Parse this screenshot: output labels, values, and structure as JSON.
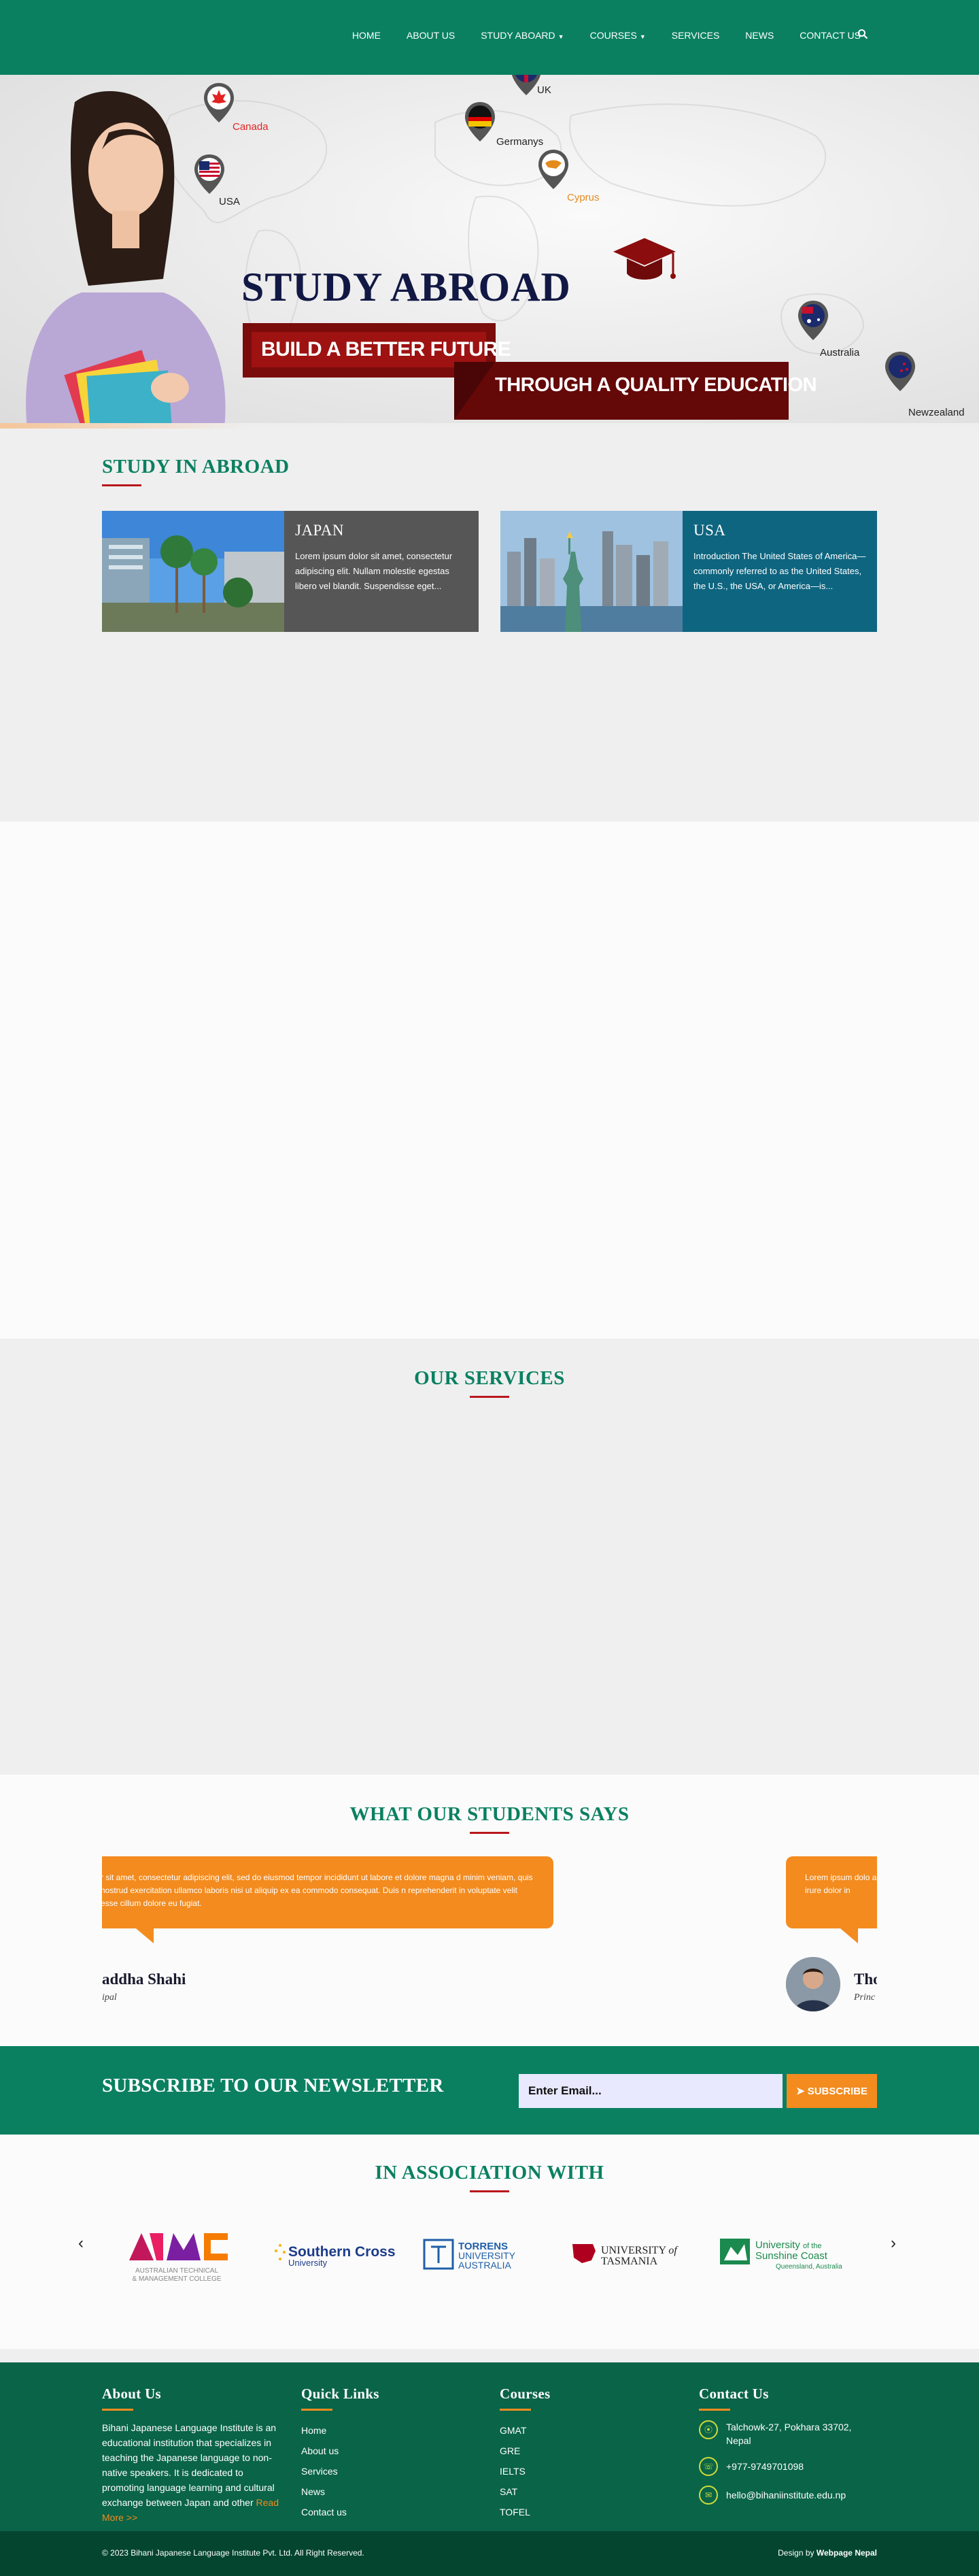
{
  "nav": {
    "items": [
      {
        "label": "HOME"
      },
      {
        "label": "ABOUT US"
      },
      {
        "label": "STUDY ABOARD"
      },
      {
        "label": "COURSES"
      },
      {
        "label": "SERVICES"
      },
      {
        "label": "NEWS"
      },
      {
        "label": "CONTACT US"
      }
    ],
    "search_icon": "search-icon"
  },
  "hero": {
    "title": "STUDY ABROAD",
    "banner1": "BUILD A BETTER FUTURE",
    "banner2": "THROUGH A QUALITY EDUCATION",
    "pins": [
      {
        "label": "Canada",
        "color": "#e32222"
      },
      {
        "label": "USA",
        "color": "#1a2a6c"
      },
      {
        "label": "UK",
        "color": "#c8102e"
      },
      {
        "label": "Germanys",
        "color": "#111111"
      },
      {
        "label": "Cyprus",
        "color": "#e48b1c"
      },
      {
        "label": "Australia",
        "color": "#1a2a6c"
      },
      {
        "label": "Newzealand",
        "color": "#1a2a6c"
      }
    ]
  },
  "abroad": {
    "title": "STUDY IN ABROAD",
    "cards": [
      {
        "title": "JAPAN",
        "text": "Lorem ipsum dolor sit amet, consectetur adipiscing elit. Nullam molestie egestas libero vel blandit. Suspendisse eget..."
      },
      {
        "title": "USA",
        "text": "Introduction The United States of America—commonly referred to as the United States, the U.S., the USA, or America—is..."
      }
    ]
  },
  "services": {
    "title": "OUR SERVICES"
  },
  "testimonials": {
    "title": "WHAT OUR STUDENTS SAYS",
    "items": [
      {
        "text": "r sit amet, consectetur adipiscing elit, sed do eiusmod tempor incididunt ut labore et dolore magna d minim veniam, quis nostrud exercitation ullamco laboris nisi ut aliquip ex ea commodo consequat. Duis n reprehenderit in voluptate velit esse cillum dolore eu fugiat.",
        "name": "addha Shahi",
        "role": "ipal"
      },
      {
        "text": "Lorem ipsum dolo aliqua. Ut enim ac aute irure dolor in",
        "name": "Tho",
        "role": "Princ"
      }
    ]
  },
  "newsletter": {
    "title": "SUBSCRIBE TO OUR NEWSLETTER",
    "placeholder": "Enter Email...",
    "button": "SUBSCRIBE"
  },
  "association": {
    "title": "IN ASSOCIATION WITH",
    "logos": [
      {
        "name": "ATMC",
        "sub": "AUSTRALIAN TECHNICAL & MANAGEMENT COLLEGE"
      },
      {
        "name": "Southern Cross",
        "sub": "University"
      },
      {
        "name": "TORRENS",
        "sub": "UNIVERSITY AUSTRALIA"
      },
      {
        "name": "UNIVERSITY of",
        "sub": "TASMANIA"
      },
      {
        "name": "University of the Sunshine Coast",
        "sub": "Queensland, Australia"
      }
    ]
  },
  "footer": {
    "about": {
      "title": "About Us",
      "text": "Bihani Japanese Language Institute is an educational institution that specializes in teaching the Japanese language to non-native speakers. It is dedicated to promoting language learning and cultural exchange between Japan and other",
      "more": "Read More >>"
    },
    "quick": {
      "title": "Quick Links",
      "items": [
        "Home",
        "About us",
        "Services",
        "News",
        "Contact us"
      ]
    },
    "courses": {
      "title": "Courses",
      "items": [
        "GMAT",
        "GRE",
        "IELTS",
        "SAT",
        "TOFEL"
      ]
    },
    "contact": {
      "title": "Contact Us",
      "address": "Talchowk-27, Pokhara 33702, Nepal",
      "phone": "+977-9749701098",
      "email": "hello@bihaniinstitute.edu.np"
    },
    "copyright": "© 2023 Bihani Japanese Language Institute Pvt. Ltd. All Right Reserved.",
    "design_prefix": "Design by",
    "design_by": "Webpage Nepal"
  }
}
